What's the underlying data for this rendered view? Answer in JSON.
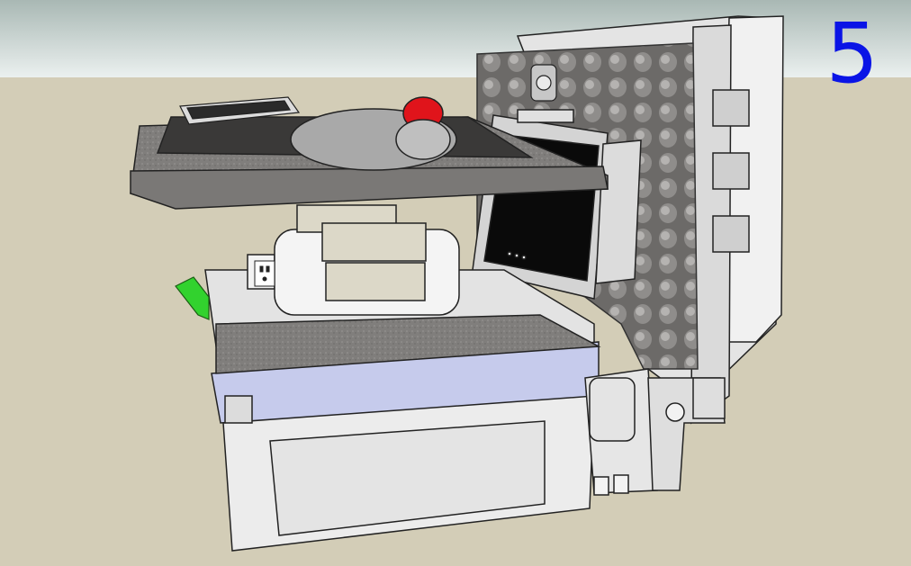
{
  "step": {
    "number": "5"
  },
  "colors": {
    "sky_top": "#a9b8b4",
    "sky_bottom": "#e9f0ef",
    "ground": "#d3cdb7",
    "case_shell": "#ececec",
    "foam": "#6e6c6a",
    "foam_light": "#9a9896",
    "tray_blue": "#c6cbec",
    "monitor_screen": "#0a0a0a",
    "trackball_red": "#e0141b",
    "latch_green": "#32d22e",
    "number_blue": "#0a14e6"
  },
  "icons": {
    "trackball": "trackball-mouse-icon",
    "keyboard": "keyboard-icon",
    "outlet": "power-outlet-icon",
    "monitor": "monitor-icon",
    "webcam": "webcam-icon"
  }
}
